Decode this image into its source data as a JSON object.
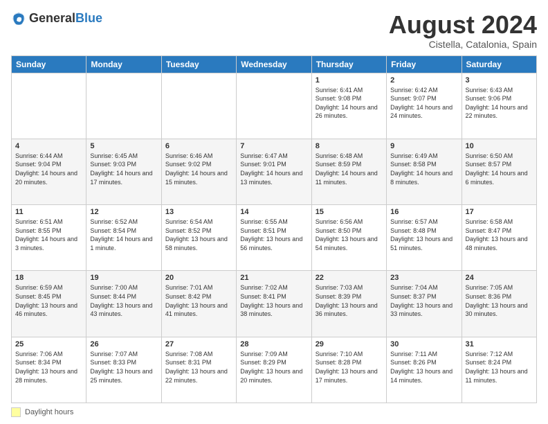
{
  "logo": {
    "text_general": "General",
    "text_blue": "Blue"
  },
  "header": {
    "title": "August 2024",
    "subtitle": "Cistella, Catalonia, Spain"
  },
  "weekdays": [
    "Sunday",
    "Monday",
    "Tuesday",
    "Wednesday",
    "Thursday",
    "Friday",
    "Saturday"
  ],
  "footer": {
    "swatch_label": "Daylight hours"
  },
  "weeks": [
    [
      {
        "day": "",
        "info": ""
      },
      {
        "day": "",
        "info": ""
      },
      {
        "day": "",
        "info": ""
      },
      {
        "day": "",
        "info": ""
      },
      {
        "day": "1",
        "info": "Sunrise: 6:41 AM\nSunset: 9:08 PM\nDaylight: 14 hours and 26 minutes."
      },
      {
        "day": "2",
        "info": "Sunrise: 6:42 AM\nSunset: 9:07 PM\nDaylight: 14 hours and 24 minutes."
      },
      {
        "day": "3",
        "info": "Sunrise: 6:43 AM\nSunset: 9:06 PM\nDaylight: 14 hours and 22 minutes."
      }
    ],
    [
      {
        "day": "4",
        "info": "Sunrise: 6:44 AM\nSunset: 9:04 PM\nDaylight: 14 hours and 20 minutes."
      },
      {
        "day": "5",
        "info": "Sunrise: 6:45 AM\nSunset: 9:03 PM\nDaylight: 14 hours and 17 minutes."
      },
      {
        "day": "6",
        "info": "Sunrise: 6:46 AM\nSunset: 9:02 PM\nDaylight: 14 hours and 15 minutes."
      },
      {
        "day": "7",
        "info": "Sunrise: 6:47 AM\nSunset: 9:01 PM\nDaylight: 14 hours and 13 minutes."
      },
      {
        "day": "8",
        "info": "Sunrise: 6:48 AM\nSunset: 8:59 PM\nDaylight: 14 hours and 11 minutes."
      },
      {
        "day": "9",
        "info": "Sunrise: 6:49 AM\nSunset: 8:58 PM\nDaylight: 14 hours and 8 minutes."
      },
      {
        "day": "10",
        "info": "Sunrise: 6:50 AM\nSunset: 8:57 PM\nDaylight: 14 hours and 6 minutes."
      }
    ],
    [
      {
        "day": "11",
        "info": "Sunrise: 6:51 AM\nSunset: 8:55 PM\nDaylight: 14 hours and 3 minutes."
      },
      {
        "day": "12",
        "info": "Sunrise: 6:52 AM\nSunset: 8:54 PM\nDaylight: 14 hours and 1 minute."
      },
      {
        "day": "13",
        "info": "Sunrise: 6:54 AM\nSunset: 8:52 PM\nDaylight: 13 hours and 58 minutes."
      },
      {
        "day": "14",
        "info": "Sunrise: 6:55 AM\nSunset: 8:51 PM\nDaylight: 13 hours and 56 minutes."
      },
      {
        "day": "15",
        "info": "Sunrise: 6:56 AM\nSunset: 8:50 PM\nDaylight: 13 hours and 54 minutes."
      },
      {
        "day": "16",
        "info": "Sunrise: 6:57 AM\nSunset: 8:48 PM\nDaylight: 13 hours and 51 minutes."
      },
      {
        "day": "17",
        "info": "Sunrise: 6:58 AM\nSunset: 8:47 PM\nDaylight: 13 hours and 48 minutes."
      }
    ],
    [
      {
        "day": "18",
        "info": "Sunrise: 6:59 AM\nSunset: 8:45 PM\nDaylight: 13 hours and 46 minutes."
      },
      {
        "day": "19",
        "info": "Sunrise: 7:00 AM\nSunset: 8:44 PM\nDaylight: 13 hours and 43 minutes."
      },
      {
        "day": "20",
        "info": "Sunrise: 7:01 AM\nSunset: 8:42 PM\nDaylight: 13 hours and 41 minutes."
      },
      {
        "day": "21",
        "info": "Sunrise: 7:02 AM\nSunset: 8:41 PM\nDaylight: 13 hours and 38 minutes."
      },
      {
        "day": "22",
        "info": "Sunrise: 7:03 AM\nSunset: 8:39 PM\nDaylight: 13 hours and 36 minutes."
      },
      {
        "day": "23",
        "info": "Sunrise: 7:04 AM\nSunset: 8:37 PM\nDaylight: 13 hours and 33 minutes."
      },
      {
        "day": "24",
        "info": "Sunrise: 7:05 AM\nSunset: 8:36 PM\nDaylight: 13 hours and 30 minutes."
      }
    ],
    [
      {
        "day": "25",
        "info": "Sunrise: 7:06 AM\nSunset: 8:34 PM\nDaylight: 13 hours and 28 minutes."
      },
      {
        "day": "26",
        "info": "Sunrise: 7:07 AM\nSunset: 8:33 PM\nDaylight: 13 hours and 25 minutes."
      },
      {
        "day": "27",
        "info": "Sunrise: 7:08 AM\nSunset: 8:31 PM\nDaylight: 13 hours and 22 minutes."
      },
      {
        "day": "28",
        "info": "Sunrise: 7:09 AM\nSunset: 8:29 PM\nDaylight: 13 hours and 20 minutes."
      },
      {
        "day": "29",
        "info": "Sunrise: 7:10 AM\nSunset: 8:28 PM\nDaylight: 13 hours and 17 minutes."
      },
      {
        "day": "30",
        "info": "Sunrise: 7:11 AM\nSunset: 8:26 PM\nDaylight: 13 hours and 14 minutes."
      },
      {
        "day": "31",
        "info": "Sunrise: 7:12 AM\nSunset: 8:24 PM\nDaylight: 13 hours and 11 minutes."
      }
    ]
  ]
}
